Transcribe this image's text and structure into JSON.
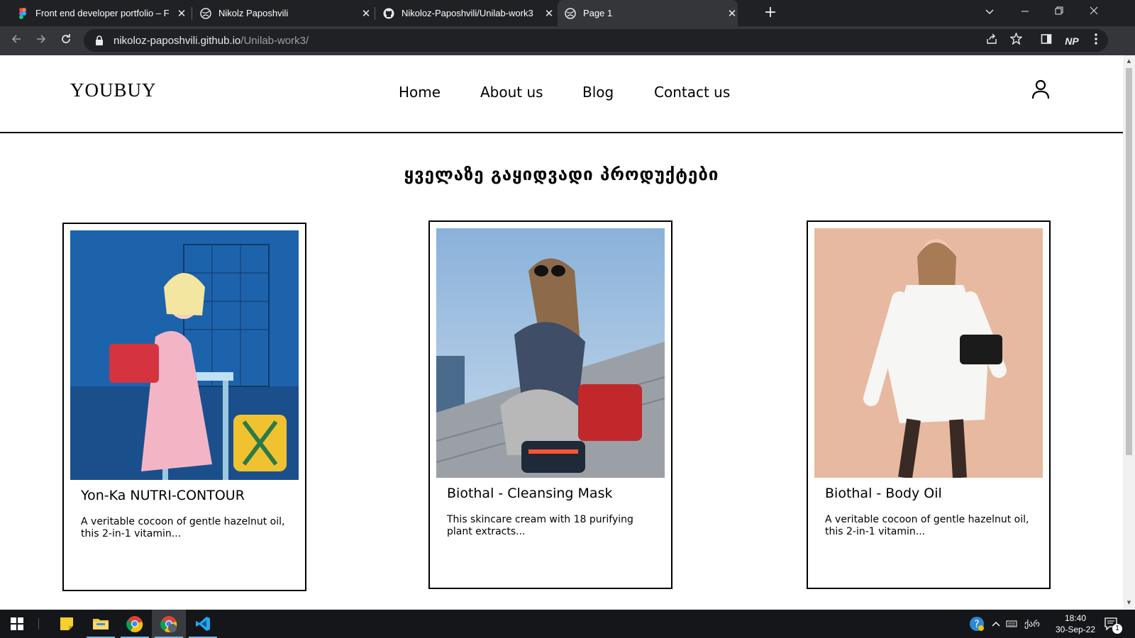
{
  "browser": {
    "tabs": [
      {
        "title": "Front end developer portfolio – F",
        "icon": "figma-icon",
        "active": false
      },
      {
        "title": "Nikolz Paposhvili",
        "icon": "globe-icon",
        "active": false
      },
      {
        "title": "Nikoloz-Paposhvili/Unilab-work3",
        "icon": "github-icon",
        "active": false
      },
      {
        "title": "Page 1",
        "icon": "globe-icon",
        "active": true
      }
    ],
    "url_host": "nikoloz-paposhvili.github.io",
    "url_path": "/Unilab-work3/",
    "profile_initials": "NP"
  },
  "site": {
    "logo": "YOUBUY",
    "nav": [
      "Home",
      "About us",
      "Blog",
      "Contact us"
    ],
    "section_title": "ყველაზე გაყიდვადი პროდუქტები",
    "products": [
      {
        "name": "Yon-Ka NUTRI-CONTOUR",
        "desc": "A veritable cocoon of gentle hazelnut oil, this 2-in-1 vitamin...",
        "bg": "#1a5fa6"
      },
      {
        "name": "Biothal - Cleansing Mask",
        "desc": "This skincare cream with 18 purifying plant extracts...",
        "bg": "#8fb4d8"
      },
      {
        "name": "Biothal - Body Oil",
        "desc": "A veritable cocoon of gentle hazelnut oil, this 2-in-1 vitamin...",
        "bg": "#e8b8a0"
      }
    ]
  },
  "taskbar": {
    "time": "18:40",
    "date": "30-Sep-22",
    "language": "ქარ",
    "notification_count": "1"
  }
}
